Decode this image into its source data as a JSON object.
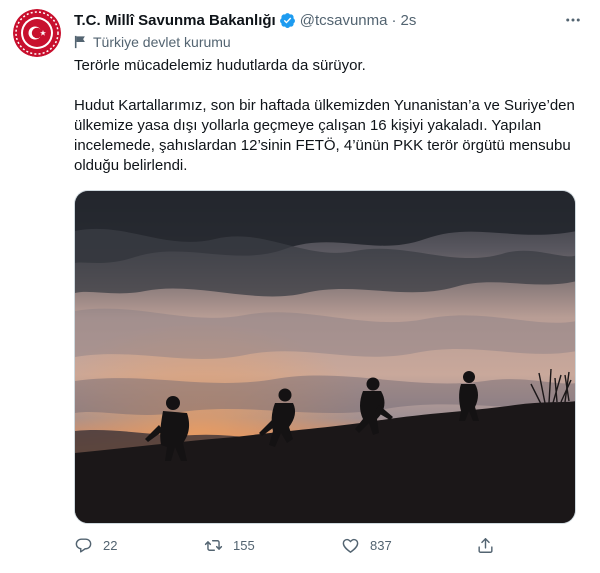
{
  "account": {
    "display_name": "T.C. Millî Savunma Bakanlığı",
    "handle": "@tcsavunma",
    "separator": "·",
    "time": "2s",
    "label": "Türkiye devlet kurumu"
  },
  "tweet": {
    "paragraph_1": "Terörle mücadelemiz hudutlarda da sürüyor.",
    "paragraph_2": "Hudut Kartallarımız, son bir haftada ülkemizden Yunanistan’a ve Suriye’den ülkemize yasa dışı yollarla geçmeye çalışan 16 kişiyi yakaladı. Yapılan incelemede, şahıslardan 12’sinin FETÖ, 4’ünün PKK terör örgütü mensubu olduğu belirlendi."
  },
  "actions": {
    "reply_count": "22",
    "retweet_count": "155",
    "like_count": "837"
  },
  "icons": {
    "avatar": "ministry-emblem",
    "verified": "verified-badge-icon",
    "label": "flag-icon",
    "more": "more-icon",
    "reply": "reply-icon",
    "retweet": "retweet-icon",
    "like": "heart-icon",
    "share": "share-icon"
  },
  "colors": {
    "text": "#0f1419",
    "secondary": "#536471",
    "verified": "#1d9bf0",
    "emblem": "#c8102e"
  }
}
